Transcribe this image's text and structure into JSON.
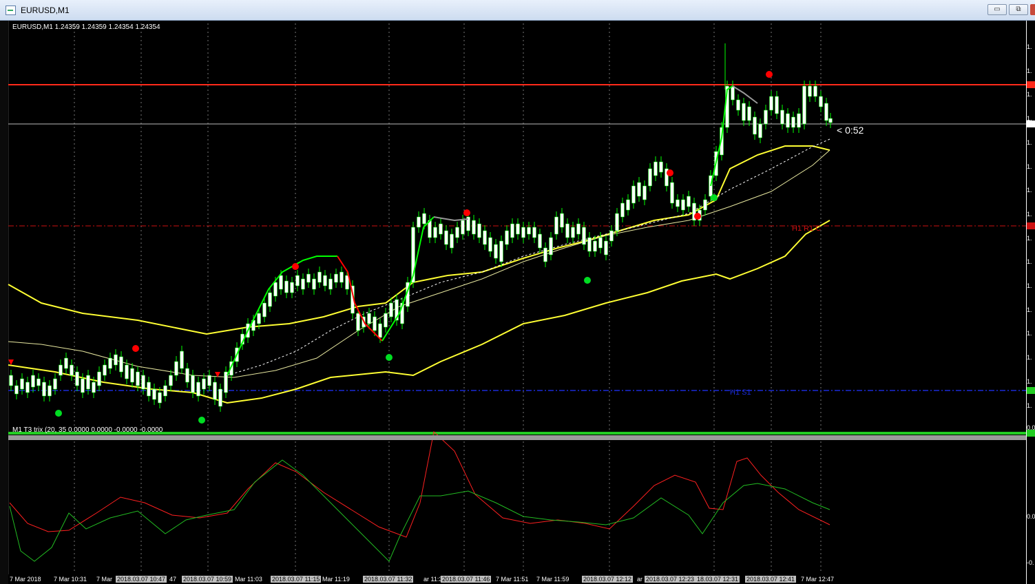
{
  "window": {
    "title": "EURUSD,M1",
    "min_label": "▭",
    "max_label": "⧉"
  },
  "main_panel": {
    "info_line": "EURUSD,M1  1.24359 1.24359 1.24354 1.24354",
    "countdown": "< 0:52",
    "levels": [
      {
        "name": "resistance",
        "color": "#ff2a1a",
        "label": ""
      },
      {
        "name": "h1-r",
        "color": "#cc1010",
        "label": "H1 R1 C"
      },
      {
        "name": "h1-s",
        "color": "#1a2bd8",
        "label": "H1 S1"
      },
      {
        "name": "support",
        "color": "#22cc22",
        "label": ""
      }
    ],
    "price_axis_ticks": [
      "1.",
      "1.",
      "1.",
      "1.",
      "1.",
      "1.",
      "1.",
      "1.",
      "1.",
      "1.",
      "1.",
      "1.",
      "1.",
      "1.",
      "1.",
      "1."
    ],
    "colors": {
      "candle": "#ffffff",
      "wick": "#00ff00",
      "ma": "#ffff33",
      "up": "#00ff00",
      "down": "#ff0000"
    }
  },
  "sub_panel": {
    "info_line": "M1 T3 trix (20, 35 0.0000 0.0000 -0.0000 -0.0000",
    "axis_ticks": [
      "0.0",
      "0.0",
      "-0."
    ],
    "colors": {
      "signal": "#ff2020",
      "main": "#22bb22"
    }
  },
  "time_axis": [
    {
      "text": "7 Mar 2018",
      "boxed": false
    },
    {
      "text": "7 Mar 10:31",
      "boxed": false
    },
    {
      "text": "7 Mar",
      "boxed": false
    },
    {
      "text": "2018.03.07 10:47",
      "boxed": true
    },
    {
      "text": "47",
      "boxed": false
    },
    {
      "text": "2018.03.07 10:59",
      "boxed": true
    },
    {
      "text": "Mar 11:03",
      "boxed": false
    },
    {
      "text": "2018.03.07 11:15",
      "boxed": true
    },
    {
      "text": "Mar 11:19",
      "boxed": false
    },
    {
      "text": "2018.03.07 11:32",
      "boxed": true
    },
    {
      "text": "ar 11:35",
      "boxed": false
    },
    {
      "text": "2018.03.07 11:46",
      "boxed": true
    },
    {
      "text": "7 Mar 11:51",
      "boxed": false
    },
    {
      "text": "7 Mar 11:59",
      "boxed": false
    },
    {
      "text": "2018.03.07 12:12",
      "boxed": true
    },
    {
      "text": "ar",
      "boxed": false
    },
    {
      "text": "2018.03.07 12:23",
      "boxed": true
    },
    {
      "text": "18.03.07 12:31",
      "boxed": true
    },
    {
      "text": "2018.03.07 12:41",
      "boxed": true
    },
    {
      "text": "7 Mar 12:47",
      "boxed": false
    }
  ]
}
